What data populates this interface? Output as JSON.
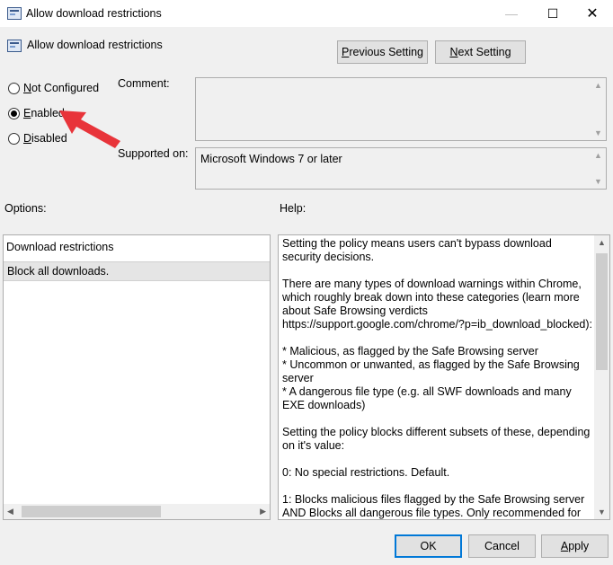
{
  "window": {
    "title": "Allow download restrictions"
  },
  "header": {
    "policy_name": "Allow download restrictions"
  },
  "buttons": {
    "previous": "Previous Setting",
    "previous_mnemonic": "P",
    "previous_rest": "revious Setting",
    "next_mnemonic": "N",
    "next_rest": "ext Setting",
    "ok": "OK",
    "cancel": "Cancel",
    "apply_mnemonic": "A",
    "apply_rest": "pply"
  },
  "state": {
    "options": [
      {
        "label_mnemonic": "N",
        "label_rest": "ot Configured",
        "checked": false
      },
      {
        "label_mnemonic": "E",
        "label_rest": "nabled",
        "checked": true
      },
      {
        "label_mnemonic": "D",
        "label_rest": "isabled",
        "checked": false
      }
    ]
  },
  "labels": {
    "comment": "Comment:",
    "supported_on": "Supported on:",
    "options": "Options:",
    "help": "Help:"
  },
  "supported_value": "Microsoft Windows 7 or later",
  "options_panel": {
    "field_label": "Download restrictions",
    "selected_value": "Block all downloads."
  },
  "help_text": "Setting the policy means users can't bypass download security decisions.\n\nThere are many types of download warnings within Chrome, which roughly break down into these categories (learn more about Safe Browsing verdicts https://support.google.com/chrome/?p=ib_download_blocked):\n\n* Malicious, as flagged by the Safe Browsing server\n* Uncommon or unwanted, as flagged by the Safe Browsing server\n* A dangerous file type (e.g. all SWF downloads and many EXE downloads)\n\nSetting the policy blocks different subsets of these, depending on it's value:\n\n0: No special restrictions. Default.\n\n1: Blocks malicious files flagged by the Safe Browsing server AND Blocks all dangerous file types. Only recommended for"
}
